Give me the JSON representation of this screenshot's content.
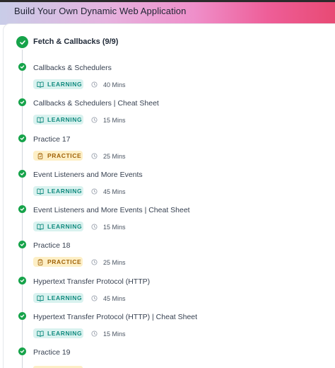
{
  "header": {
    "title": "Build Your Own Dynamic Web Application"
  },
  "section": {
    "title": "Fetch & Callbacks (9/9)"
  },
  "items": [
    {
      "title": "Callbacks & Schedulers",
      "type": "LEARNING",
      "duration": "40 Mins"
    },
    {
      "title": "Callbacks & Schedulers | Cheat Sheet",
      "type": "LEARNING",
      "duration": "15 Mins"
    },
    {
      "title": "Practice 17",
      "type": "PRACTICE",
      "duration": "25 Mins"
    },
    {
      "title": "Event Listeners and More Events",
      "type": "LEARNING",
      "duration": "45 Mins"
    },
    {
      "title": "Event Listeners and More Events | Cheat Sheet",
      "type": "LEARNING",
      "duration": "15 Mins"
    },
    {
      "title": "Practice 18",
      "type": "PRACTICE",
      "duration": "25 Mins"
    },
    {
      "title": "Hypertext Transfer Protocol (HTTP)",
      "type": "LEARNING",
      "duration": "45 Mins"
    },
    {
      "title": "Hypertext Transfer Protocol (HTTP) | Cheat Sheet",
      "type": "LEARNING",
      "duration": "15 Mins"
    },
    {
      "title": "Practice 19",
      "type": "PRACTICE",
      "duration": ""
    }
  ],
  "icons": {
    "status": "check-circle-icon",
    "learning": "open-book-icon",
    "practice": "clipboard-icon",
    "duration": "clock-icon"
  },
  "colors": {
    "complete": "#16a34a",
    "learning_bg": "#d9f2ef",
    "learning_fg": "#0f8a7e",
    "practice_bg": "#fdefc6",
    "practice_fg": "#a16207"
  }
}
